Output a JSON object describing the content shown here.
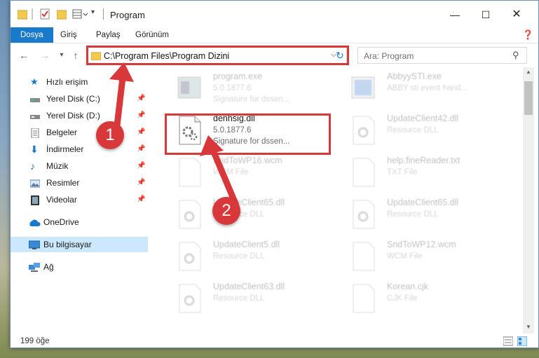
{
  "window": {
    "title": "Program"
  },
  "ribbon": {
    "tabs": [
      "Dosya",
      "Giriş",
      "Paylaş",
      "Görünüm"
    ]
  },
  "address": {
    "path": "C:\\Program Files\\Program Dizini"
  },
  "search": {
    "placeholder": "Ara: Program"
  },
  "sidebar": {
    "items": [
      {
        "label": "Hızlı erişim"
      },
      {
        "label": "Yerel Disk (C:)"
      },
      {
        "label": "Yerel Disk (D:)"
      },
      {
        "label": "Belgeler"
      },
      {
        "label": "İndirmeler"
      },
      {
        "label": "Müzik"
      },
      {
        "label": "Resimler"
      },
      {
        "label": "Videolar"
      },
      {
        "label": "OneDrive"
      },
      {
        "label": "Bu bilgisayar"
      },
      {
        "label": "Ağ"
      }
    ]
  },
  "files": [
    {
      "name": "program.exe",
      "line2": "5.0.1877.6",
      "line3": "Signature for dssen..."
    },
    {
      "name": "AbbyySTI.exe",
      "line2": "ABBY sti event hand...",
      "line3": ""
    },
    {
      "name": "denhsig.dll",
      "line2": "5.0.1877.6",
      "line3": "Signature for dssen..."
    },
    {
      "name": "UpdateClient42.dll",
      "line2": "Resource DLL",
      "line3": ""
    },
    {
      "name": "SndToWP16.wcm",
      "line2": "WCM File",
      "line3": ""
    },
    {
      "name": "help.fineReader.txt",
      "line2": "TXT File",
      "line3": ""
    },
    {
      "name": "UpdateClient65.dll",
      "line2": "Resource DLL",
      "line3": ""
    },
    {
      "name": "UpdateClient65.dll",
      "line2": "Resource DLL",
      "line3": ""
    },
    {
      "name": "UpdateClient5.dll",
      "line2": "Resource DLL",
      "line3": ""
    },
    {
      "name": "SndToWP12.wcm",
      "line2": "WCM File",
      "line3": ""
    },
    {
      "name": "UpdateClient63.dll",
      "line2": "Resource DLL",
      "line3": ""
    },
    {
      "name": "Korean.cjk",
      "line2": "CJK File",
      "line3": ""
    }
  ],
  "status": {
    "count": "199 öğe"
  },
  "annotations": {
    "badge1": "1",
    "badge2": "2"
  }
}
